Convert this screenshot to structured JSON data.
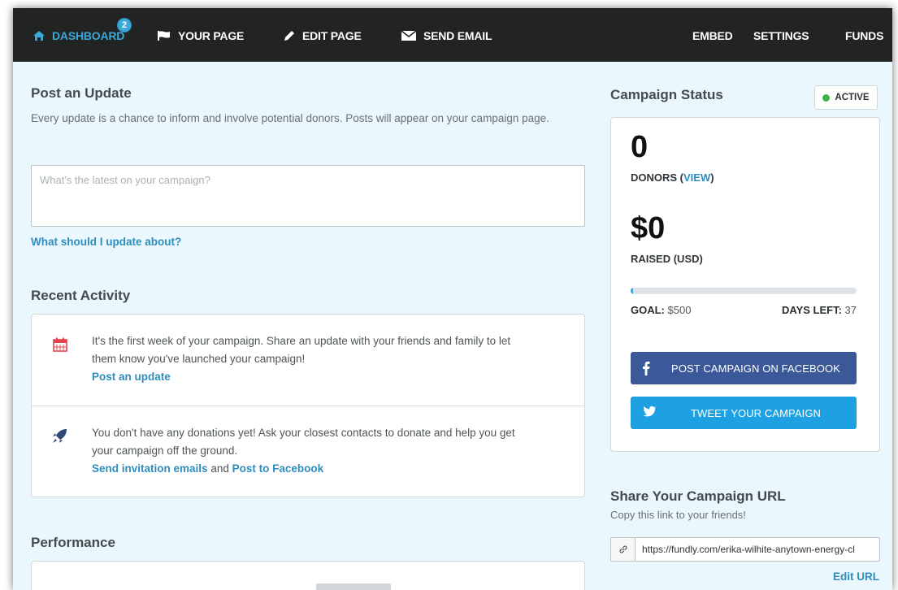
{
  "nav": {
    "dashboard": "DASHBOARD",
    "dashboard_badge": "2",
    "your_page": "YOUR PAGE",
    "edit_page": "EDIT PAGE",
    "send_email": "SEND EMAIL",
    "embed": "EMBED",
    "settings": "SETTINGS",
    "funds": "FUNDS"
  },
  "post_update": {
    "title": "Post an Update",
    "description": "Every update is a chance to inform and involve potential donors. Posts will appear on your campaign page.",
    "placeholder": "What's the latest on your campaign?",
    "help_link": "What should I update about?"
  },
  "recent_activity": {
    "title": "Recent Activity",
    "items": [
      {
        "icon": "calendar-icon",
        "text": "It's the first week of your campaign. Share an update with your friends and family to let them know you've launched your campaign!",
        "link": "Post an update"
      },
      {
        "icon": "rocket-icon",
        "text": "You don't have any donations yet! Ask your closest contacts to donate and help you get your campaign off the ground.",
        "link1": "Send invitation emails",
        "connector": "and",
        "link2": "Post to Facebook"
      }
    ]
  },
  "performance": {
    "title": "Performance"
  },
  "campaign_status": {
    "title": "Campaign Status",
    "status": "ACTIVE",
    "status_color": "#3cb54a",
    "donors_count": "0",
    "donors_label": "DONORS (",
    "donors_view": "VIEW",
    "donors_close": ")",
    "raised_amount": "$0",
    "raised_label": "RAISED (USD)",
    "progress_fraction": 0.01,
    "goal_label": "GOAL:",
    "goal_value": "$500",
    "days_left_label": "DAYS LEFT:",
    "days_left_value": "37",
    "facebook_button": "POST CAMPAIGN ON FACEBOOK",
    "tweet_button": "TWEET YOUR CAMPAIGN"
  },
  "share": {
    "title": "Share Your Campaign URL",
    "subtitle": "Copy this link to your friends!",
    "url": "https://fundly.com/erika-wilhite-anytown-energy-cl",
    "edit_link": "Edit URL"
  },
  "colors": {
    "accent": "#3aa8d8",
    "facebook": "#3b5998",
    "twitter": "#1da1e2",
    "nav_bg": "#222424"
  }
}
